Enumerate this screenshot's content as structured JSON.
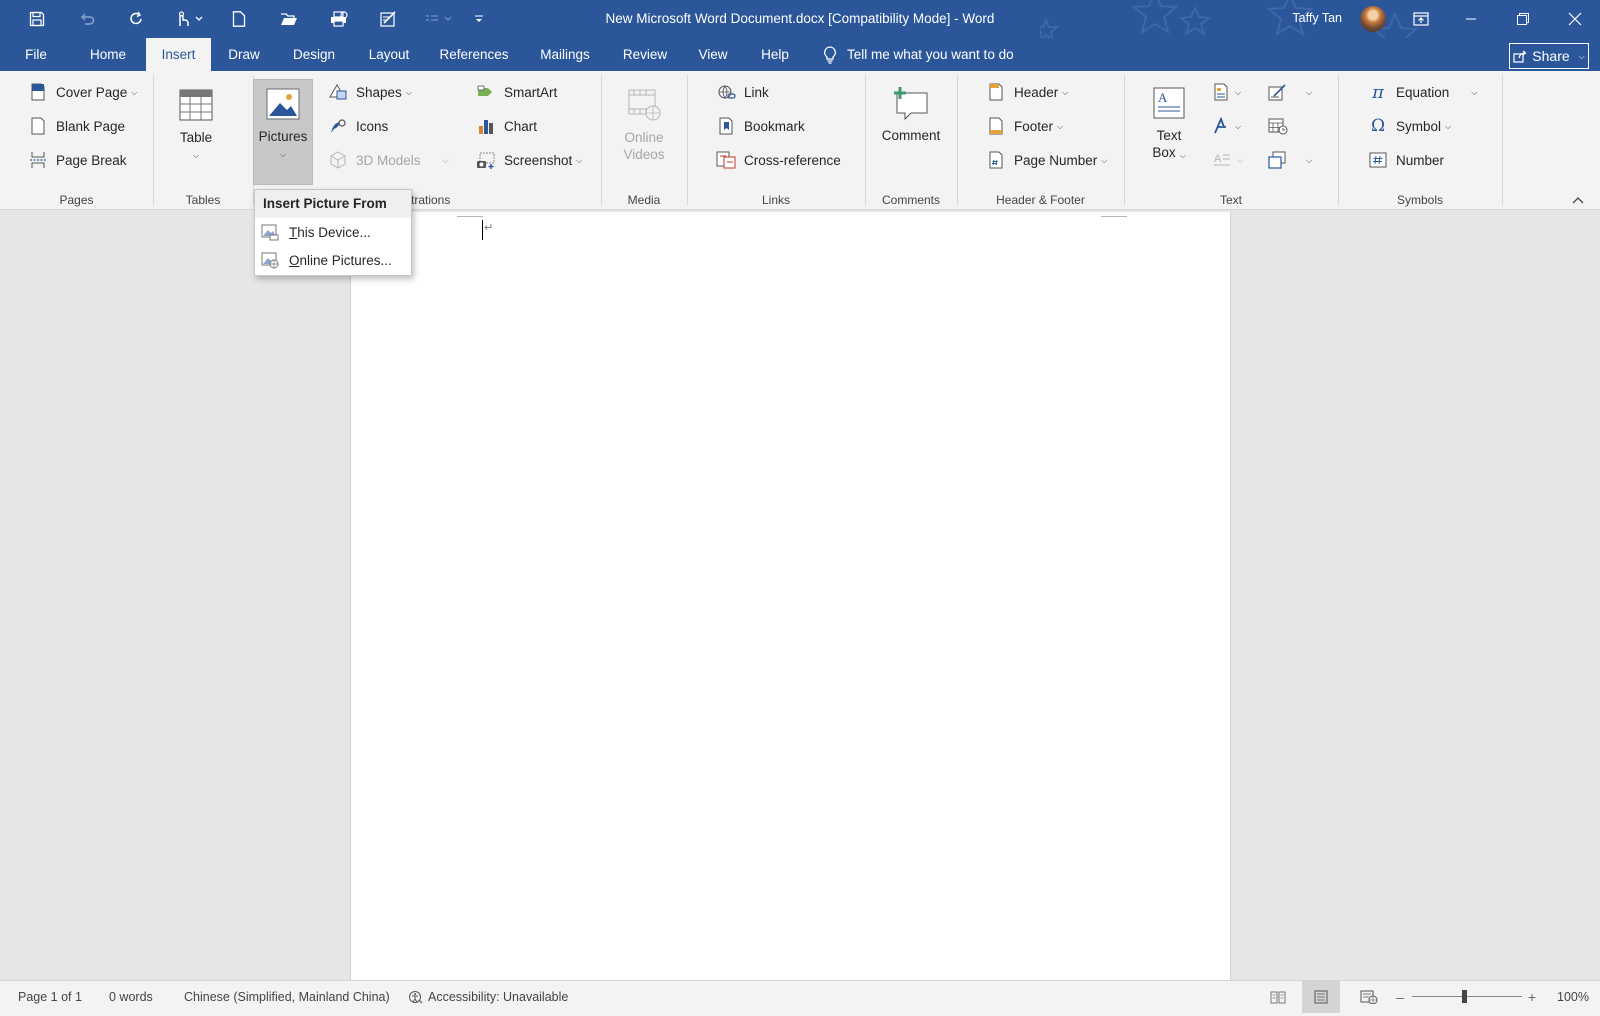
{
  "window": {
    "title": "New Microsoft Word Document.docx [Compatibility Mode]  -  Word",
    "user_name": "Taffy Tan",
    "accent_color": "#2b579a"
  },
  "quick_access": [
    "save-icon",
    "undo-icon",
    "redo-icon",
    "touch-mode-icon",
    "new-document-icon",
    "open-icon",
    "print-preview-icon",
    "edit-icon",
    "list-icon",
    "customize-icon"
  ],
  "tabs": {
    "file": "File",
    "home": "Home",
    "insert": "Insert",
    "draw": "Draw",
    "design": "Design",
    "layout": "Layout",
    "references": "References",
    "mailings": "Mailings",
    "review": "Review",
    "view": "View",
    "help": "Help",
    "active": "Insert"
  },
  "tell_me": "Tell me what you want to do",
  "share": "Share",
  "ribbon": {
    "pages": {
      "label": "Pages",
      "cover_page": "Cover Page",
      "blank_page": "Blank Page",
      "page_break": "Page Break"
    },
    "tables": {
      "label": "Tables",
      "table": "Table"
    },
    "illustrations": {
      "label_visible": "trations",
      "pictures": "Pictures",
      "shapes": "Shapes",
      "icons": "Icons",
      "models_3d": "3D Models",
      "smartart": "SmartArt",
      "chart": "Chart",
      "screenshot": "Screenshot"
    },
    "media": {
      "label": "Media",
      "online_videos_line1": "Online",
      "online_videos_line2": "Videos"
    },
    "links": {
      "label": "Links",
      "link": "Link",
      "bookmark": "Bookmark",
      "cross_reference": "Cross-reference"
    },
    "comments": {
      "label": "Comments",
      "comment": "Comment"
    },
    "header_footer": {
      "label": "Header & Footer",
      "header": "Header",
      "footer": "Footer",
      "page_number": "Page Number"
    },
    "text": {
      "label": "Text",
      "text_box_line1": "Text",
      "text_box_line2": "Box"
    },
    "symbols": {
      "label": "Symbols",
      "equation": "Equation",
      "symbol": "Symbol",
      "number": "Number"
    }
  },
  "picture_menu": {
    "header": "Insert Picture From",
    "this_device_u": "T",
    "this_device_rest": "his Device...",
    "online_pictures_u": "O",
    "online_pictures_rest": "nline Pictures..."
  },
  "status": {
    "page": "Page 1 of 1",
    "words": "0 words",
    "language": "Chinese (Simplified, Mainland China)",
    "accessibility": "Accessibility: Unavailable",
    "zoom": "100%",
    "zoom_level_percent": 100
  }
}
